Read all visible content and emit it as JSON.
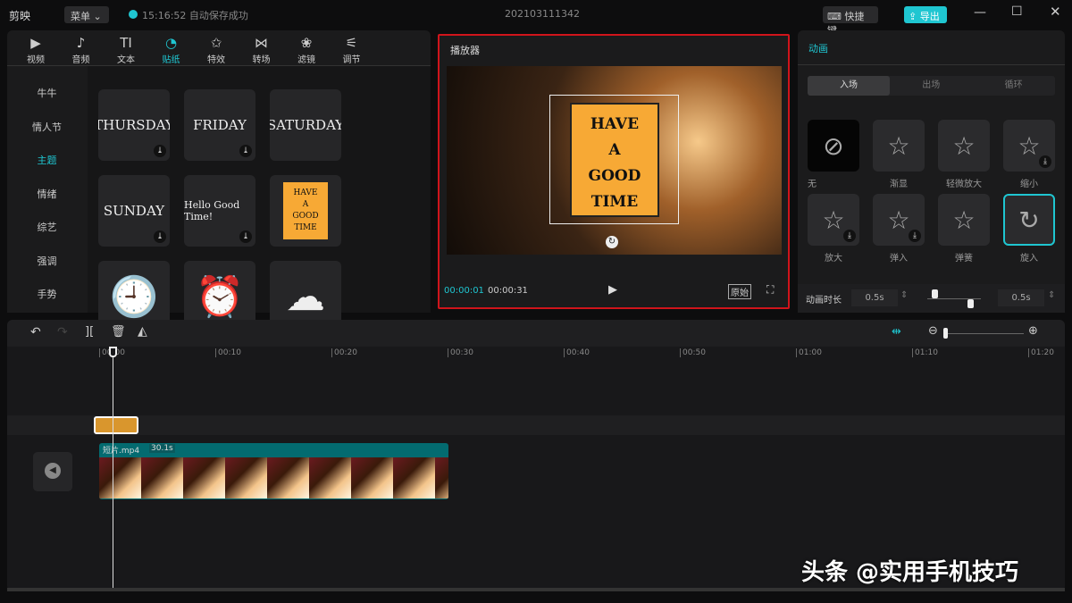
{
  "app": {
    "logo": "剪映",
    "menu": "菜单",
    "save_status": "15:16:52 自动保存成功",
    "project": "202103111342",
    "shortcut": "快捷键",
    "export": "导出"
  },
  "media_tabs": [
    {
      "label": "视频",
      "icon": "video-icon",
      "glyph": "▶"
    },
    {
      "label": "音频",
      "icon": "audio-icon",
      "glyph": "♪"
    },
    {
      "label": "文本",
      "icon": "text-icon",
      "glyph": "TI"
    },
    {
      "label": "贴纸",
      "icon": "sticker-icon",
      "glyph": "◔",
      "active": true
    },
    {
      "label": "特效",
      "icon": "effects-icon",
      "glyph": "✩"
    },
    {
      "label": "转场",
      "icon": "transition-icon",
      "glyph": "⋈"
    },
    {
      "label": "滤镜",
      "icon": "filter-icon",
      "glyph": "❀"
    },
    {
      "label": "调节",
      "icon": "adjust-icon",
      "glyph": "⚟"
    }
  ],
  "categories": [
    "牛牛",
    "情人节",
    "主题",
    "情绪",
    "综艺",
    "强调",
    "手势"
  ],
  "active_category": "主题",
  "stickers": [
    {
      "text": "THURSDAY",
      "download": true
    },
    {
      "text": "FRIDAY",
      "download": true
    },
    {
      "text": "SATURDAY",
      "download": false
    },
    {
      "text": "SUNDAY",
      "download": true
    },
    {
      "text": "Hello Good Time!",
      "download": true
    },
    {
      "text": "HAVE A GOOD TIME",
      "download": false
    },
    {
      "text": "🕘",
      "download": false
    },
    {
      "text": "⏰",
      "download": false
    },
    {
      "text": "☁",
      "download": false
    }
  ],
  "player": {
    "title": "播放器",
    "current": "00:00:01",
    "total": "00:00:31",
    "ratio": "原始",
    "sticker_text": "HAVE A GOOD TIME"
  },
  "animation": {
    "title": "动画",
    "tabs": [
      "入场",
      "出场",
      "循环"
    ],
    "active_tab": "入场",
    "items": [
      {
        "label": "无",
        "glyph": "⊘"
      },
      {
        "label": "渐显",
        "glyph": "☆"
      },
      {
        "label": "轻微放大",
        "glyph": "☆"
      },
      {
        "label": "缩小",
        "glyph": "☆",
        "download": true
      },
      {
        "label": "放大",
        "glyph": "☆",
        "download": true
      },
      {
        "label": "弹入",
        "glyph": "☆",
        "download": true
      },
      {
        "label": "弹簧",
        "glyph": "☆"
      },
      {
        "label": "旋入",
        "glyph": "↻",
        "selected": true
      }
    ],
    "duration_label": "动画时长",
    "duration_in": "0.5s",
    "duration_out": "0.5s"
  },
  "timeline": {
    "ticks": [
      "00:00",
      "00:10",
      "00:20",
      "00:30",
      "00:40",
      "00:50",
      "01:00",
      "01:10",
      "01:20"
    ],
    "clip_name": "短片.mp4",
    "clip_duration": "30.1s"
  },
  "watermark": "头条 @实用手机技巧",
  "colors": {
    "accent": "#1fc6d1",
    "clip": "#036b70",
    "player_border": "#d0141b"
  }
}
